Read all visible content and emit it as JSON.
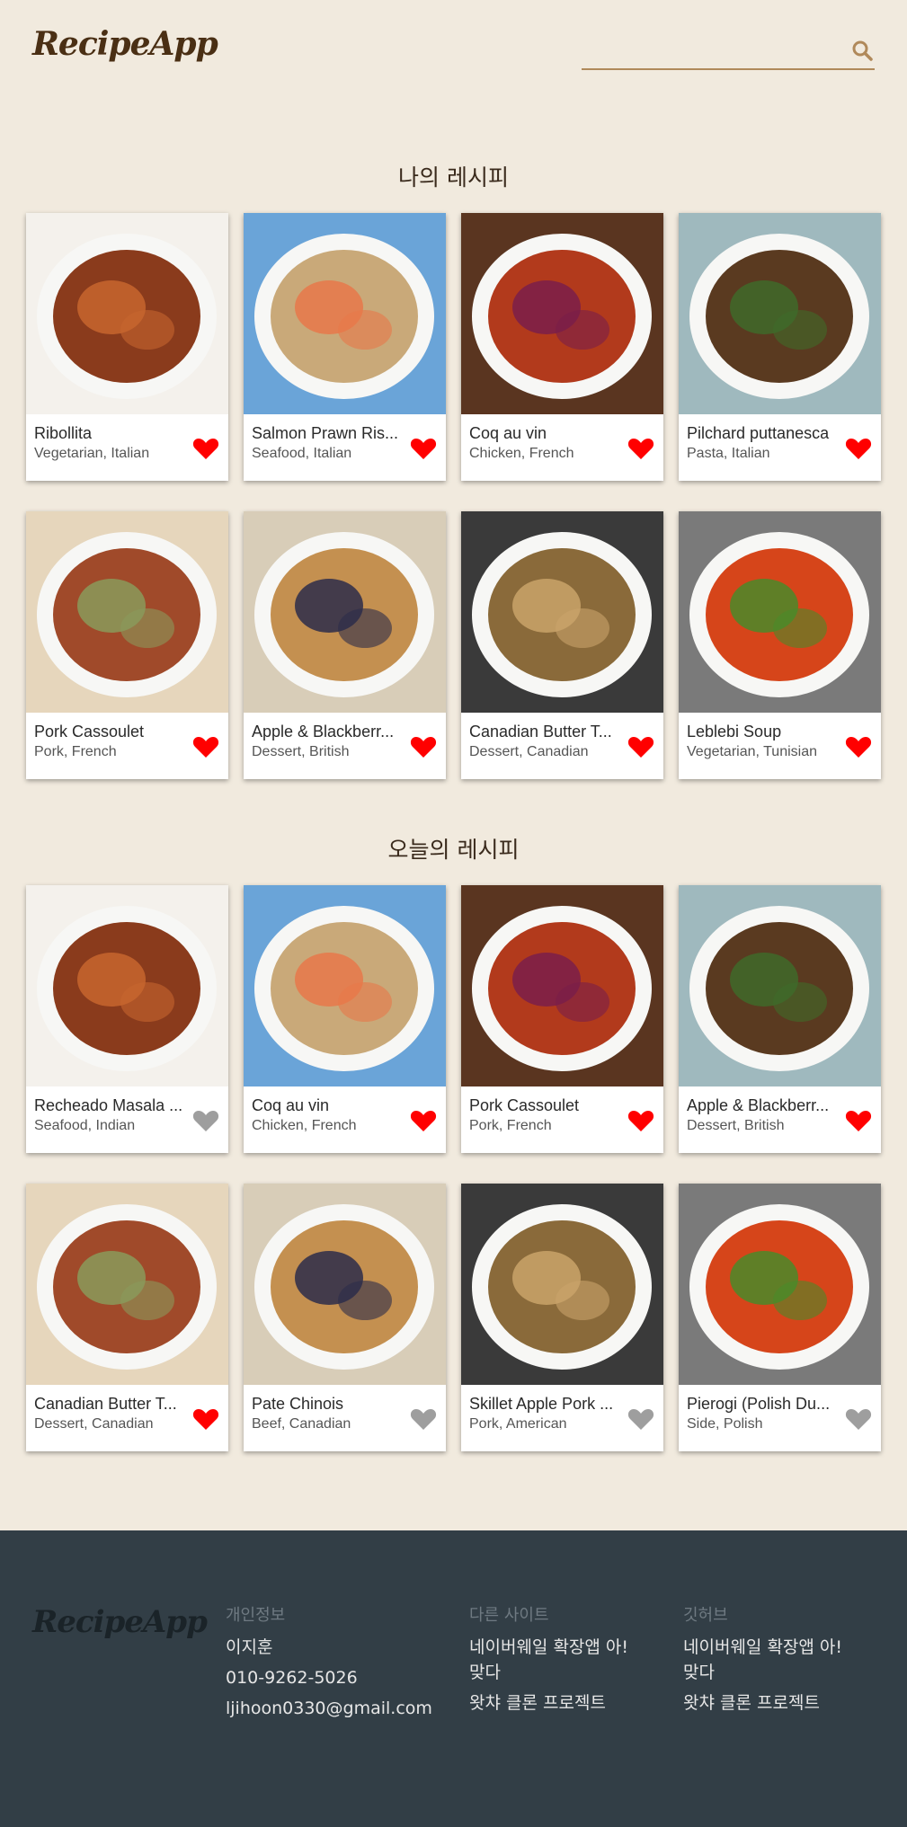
{
  "header": {
    "logo": "RecipeApp",
    "search_placeholder": ""
  },
  "colors": {
    "background": "#f1eade",
    "accent": "#b0895a",
    "heart_active": "#ff0000",
    "heart_inactive": "#9e9e9e",
    "footer_bg": "#323e46"
  },
  "my_recipes": {
    "title": "나의 레시피",
    "rows": [
      [
        {
          "name": "Ribollita",
          "category": "Vegetarian, Italian",
          "favorite": true
        },
        {
          "name": "Salmon Prawn Ris...",
          "category": "Seafood, Italian",
          "favorite": true
        },
        {
          "name": "Coq au vin",
          "category": "Chicken, French",
          "favorite": true
        },
        {
          "name": "Pilchard puttanesca",
          "category": "Pasta, Italian",
          "favorite": true
        }
      ],
      [
        {
          "name": "Pork Cassoulet",
          "category": "Pork, French",
          "favorite": true
        },
        {
          "name": "Apple & Blackberr...",
          "category": "Dessert, British",
          "favorite": true
        },
        {
          "name": "Canadian Butter T...",
          "category": "Dessert, Canadian",
          "favorite": true
        },
        {
          "name": "Leblebi Soup",
          "category": "Vegetarian, Tunisian",
          "favorite": true
        }
      ]
    ]
  },
  "today_recipes": {
    "title": "오늘의 레시피",
    "rows": [
      [
        {
          "name": "Recheado Masala ...",
          "category": "Seafood, Indian",
          "favorite": false
        },
        {
          "name": "Coq au vin",
          "category": "Chicken, French",
          "favorite": true
        },
        {
          "name": "Pork Cassoulet",
          "category": "Pork, French",
          "favorite": true
        },
        {
          "name": "Apple & Blackberr...",
          "category": "Dessert, British",
          "favorite": true
        }
      ],
      [
        {
          "name": "Canadian Butter T...",
          "category": "Dessert, Canadian",
          "favorite": true
        },
        {
          "name": "Pate Chinois",
          "category": "Beef, Canadian",
          "favorite": false
        },
        {
          "name": "Skillet Apple Pork ...",
          "category": "Pork, American",
          "favorite": false
        },
        {
          "name": "Pierogi (Polish Du...",
          "category": "Side, Polish",
          "favorite": false
        }
      ]
    ]
  },
  "footer": {
    "logo": "RecipeApp",
    "personal": {
      "heading": "개인정보",
      "name": "이지훈",
      "phone": "010-9262-5026",
      "email": "ljihoon0330@gmail.com"
    },
    "other_sites": {
      "heading": "다른 사이트",
      "links": [
        "네이버웨일 확장앱 아! 맞다",
        "왓챠 클론 프로젝트"
      ]
    },
    "github": {
      "heading": "깃허브",
      "links": [
        "네이버웨일 확장앱 아! 맞다",
        "왓챠 클론 프로젝트"
      ]
    }
  }
}
